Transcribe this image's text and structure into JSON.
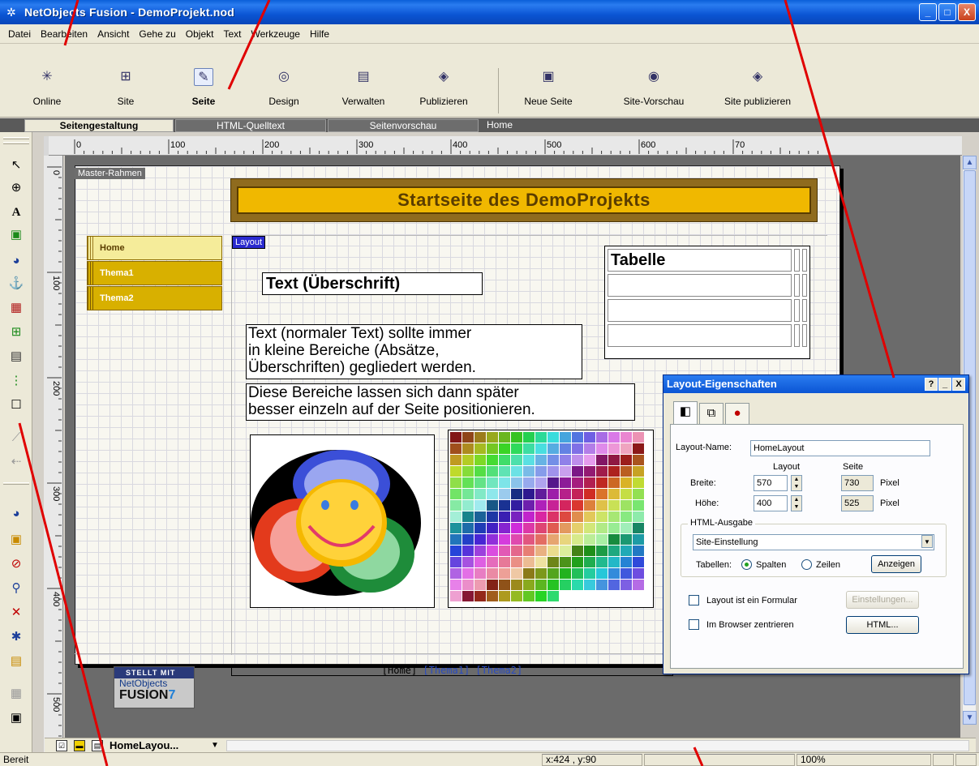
{
  "window": {
    "title": "NetObjects Fusion - DemoProjekt.nod",
    "buttons": [
      "_",
      "□",
      "X"
    ]
  },
  "menu": [
    "Datei",
    "Bearbeiten",
    "Ansicht",
    "Gehe zu",
    "Objekt",
    "Text",
    "Werkzeuge",
    "Hilfe"
  ],
  "toolbar": [
    {
      "label": "Online",
      "icon": "online-icon"
    },
    {
      "label": "Site",
      "icon": "site-icon"
    },
    {
      "label": "Seite",
      "icon": "page-icon",
      "active": true
    },
    {
      "label": "Design",
      "icon": "design-icon"
    },
    {
      "label": "Verwalten",
      "icon": "manage-icon"
    },
    {
      "label": "Publizieren",
      "icon": "publish-icon"
    },
    {
      "label": "Neue Seite",
      "icon": "new-page-icon"
    },
    {
      "label": "Site-Vorschau",
      "icon": "site-preview-icon"
    },
    {
      "label": "Site publizieren",
      "icon": "site-publish-icon"
    }
  ],
  "tabs": [
    "Seitengestaltung",
    "HTML-Quelltext",
    "Seitenvorschau",
    "Home"
  ],
  "ruler": {
    "top_labels": [
      "0",
      "100",
      "200",
      "300",
      "400",
      "500",
      "600",
      "70"
    ],
    "left_labels": [
      "0",
      "100",
      "200",
      "300",
      "400",
      "500"
    ]
  },
  "page": {
    "master_label": "Master-Rahmen",
    "layout_label": "Layout",
    "banner": "Startseite des DemoProjekts",
    "nav": [
      "Home",
      "Thema1",
      "Thema2"
    ],
    "heading": "Text (Überschrift)",
    "para1": [
      "Text (normaler Text) sollte immer",
      "in kleine Bereiche (Absätze,",
      "Überschriften) gegliedert werden."
    ],
    "para2": [
      "Diese Bereiche lassen sich dann später",
      "besser einzeln auf der Seite positionieren."
    ],
    "table_header": "Tabelle",
    "footer_nav": {
      "home": "[Home]",
      "t1": "[Thema1]",
      "t2": "[Thema2]"
    },
    "logo": {
      "top": "STELLT MIT",
      "mid": "NetObjects",
      "big": "FUSION",
      "num": "7"
    }
  },
  "layoutbar": {
    "name": "HomeLayou..."
  },
  "status": {
    "ready": "Bereit",
    "coords": "x:424 , y:90",
    "zoom": "100%"
  },
  "dialog": {
    "title": "Layout-Eigenschaften",
    "title_buttons": [
      "?",
      "_",
      "X"
    ],
    "name_label": "Layout-Name:",
    "name_value": "HomeLayout",
    "col_layout": "Layout",
    "col_page": "Seite",
    "width_label": "Breite:",
    "height_label": "Höhe:",
    "width_value": "570",
    "height_value": "400",
    "page_width": "730",
    "page_height": "525",
    "unit": "Pixel",
    "html_group": "HTML-Ausgabe",
    "html_select": "Site-Einstellung",
    "tables_label": "Tabellen:",
    "opt_cols": "Spalten",
    "opt_rows": "Zeilen",
    "show_btn": "Anzeigen",
    "chk_form": "Layout ist ein Formular",
    "settings_btn": "Einstellungen...",
    "chk_center": "Im Browser zentrieren",
    "html_btn": "HTML..."
  },
  "colors": {
    "accent": "#0b55d4",
    "banner": "#f0b800",
    "annotation": "#e00000"
  }
}
